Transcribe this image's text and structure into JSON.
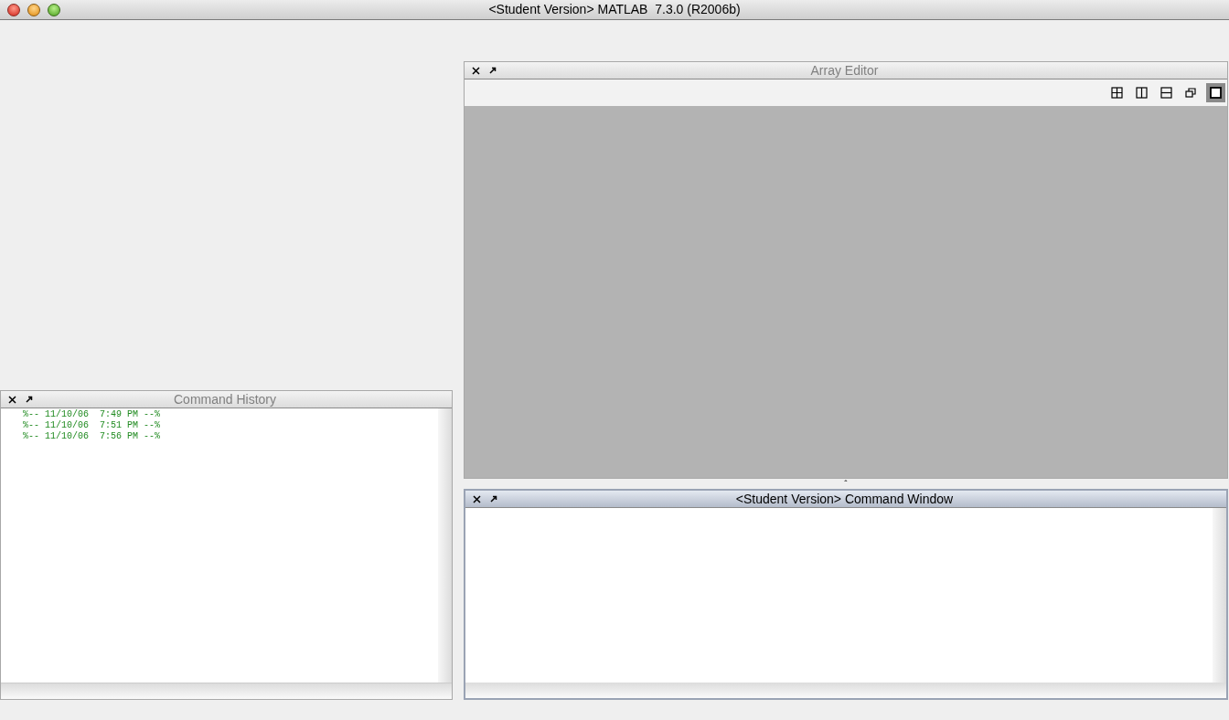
{
  "window": {
    "title": "<Student Version> MATLAB  7.3.0 (R2006b)"
  },
  "command_history": {
    "title": "Command History",
    "active": false,
    "lines": [
      "%-- 11/10/06  7:49 PM --%",
      "%-- 11/10/06  7:51 PM --%",
      "%-- 11/10/06  7:56 PM --%"
    ]
  },
  "array_editor": {
    "title": "Array Editor",
    "active": false,
    "layout_buttons": [
      {
        "kind": "grid",
        "selected": false
      },
      {
        "kind": "columns",
        "selected": false
      },
      {
        "kind": "rows",
        "selected": false
      },
      {
        "kind": "float",
        "selected": false
      },
      {
        "kind": "maximize",
        "selected": true
      }
    ]
  },
  "splitter": {
    "label": "ˆ"
  },
  "command_window": {
    "title": "<Student Version> Command Window",
    "active": true
  }
}
